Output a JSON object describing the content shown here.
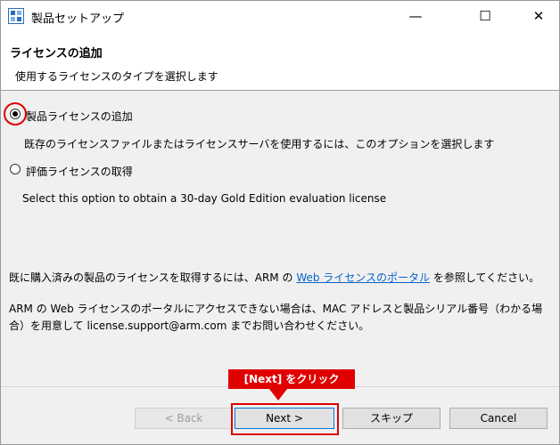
{
  "window": {
    "title": "製品セットアップ"
  },
  "header": {
    "title": "ライセンスの追加",
    "subtitle": "使用するライセンスのタイプを選択します"
  },
  "options": [
    {
      "label": "製品ライセンスの追加",
      "description": "既存のライセンスファイルまたはライセンスサーバを使用するには、このオプションを選択します",
      "selected": true
    },
    {
      "label": "評価ライセンスの取得",
      "description": "Select this option to obtain a 30-day Gold Edition evaluation license",
      "selected": false
    }
  ],
  "info": {
    "line1_before": "既に購入済みの製品のライセンスを取得するには、ARM の",
    "link": "Web ライセンスのポータル",
    "line1_after": "を参照してください。",
    "line2": "ARM の Web ライセンスのポータルにアクセスできない場合は、MAC アドレスと製品シリアル番号（わかる場合）を用意して license.support@arm.com までお問い合わせください。"
  },
  "buttons": {
    "back": "< Back",
    "next": "Next >",
    "skip": "スキップ",
    "cancel": "Cancel"
  },
  "annotation": {
    "callout": "[Next] をクリック"
  },
  "colors": {
    "highlight": "#e00000",
    "link": "#0a64c8",
    "focus": "#0078d7"
  }
}
